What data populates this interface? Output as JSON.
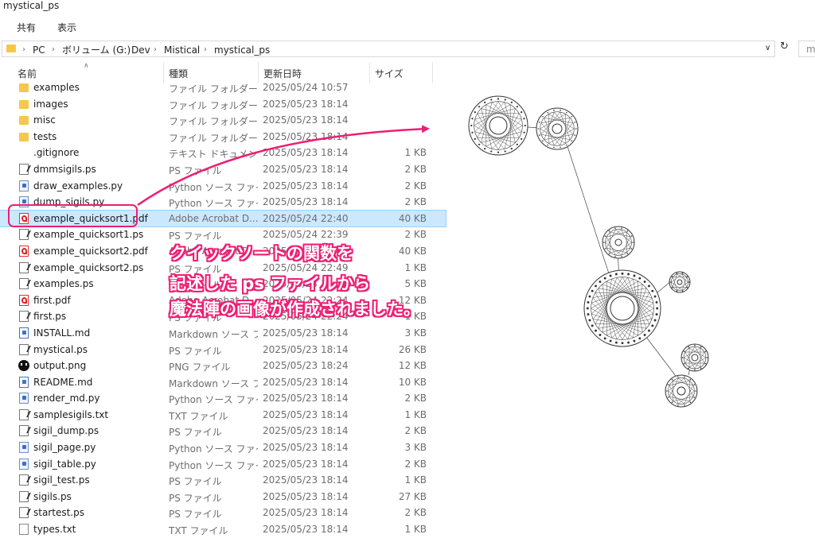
{
  "window": {
    "title": "mystical_ps"
  },
  "ribbon": {
    "tabs": [
      "共有",
      "表示"
    ]
  },
  "address": {
    "crumbs": [
      "PC",
      "ボリューム (G:)",
      "Dev",
      "Mistical",
      "mystical_ps"
    ],
    "search_text": "my"
  },
  "columns": {
    "name": "名前",
    "type": "種類",
    "date": "更新日時",
    "size": "サイズ"
  },
  "files": [
    {
      "name": "examples",
      "type": "ファイル フォルダー",
      "date": "2025/05/24 10:57",
      "size": "",
      "icon": "folder"
    },
    {
      "name": "images",
      "type": "ファイル フォルダー",
      "date": "2025/05/23 18:14",
      "size": "",
      "icon": "folder"
    },
    {
      "name": "misc",
      "type": "ファイル フォルダー",
      "date": "2025/05/23 18:14",
      "size": "",
      "icon": "folder"
    },
    {
      "name": "tests",
      "type": "ファイル フォルダー",
      "date": "2025/05/23 18:14",
      "size": "",
      "icon": "folder"
    },
    {
      "name": ".gitignore",
      "type": "テキスト ドキュメント",
      "date": "2025/05/23 18:14",
      "size": "1 KB",
      "icon": "generic"
    },
    {
      "name": "dmmsigils.ps",
      "type": "PS ファイル",
      "date": "2025/05/23 18:14",
      "size": "2 KB",
      "icon": "ps"
    },
    {
      "name": "draw_examples.py",
      "type": "Python ソース ファイル",
      "date": "2025/05/23 18:14",
      "size": "2 KB",
      "icon": "py"
    },
    {
      "name": "dump_sigils.py",
      "type": "Python ソース ファイル",
      "date": "2025/05/23 18:14",
      "size": "2 KB",
      "icon": "py"
    },
    {
      "name": "example_quicksort1.pdf",
      "type": "Adobe Acrobat D...",
      "date": "2025/05/24 22:40",
      "size": "40 KB",
      "icon": "pdf",
      "selected": true
    },
    {
      "name": "example_quicksort1.ps",
      "type": "PS ファイル",
      "date": "2025/05/24 22:39",
      "size": "2 KB",
      "icon": "ps"
    },
    {
      "name": "example_quicksort2.pdf",
      "type": "Adobe Acrobat D...",
      "date": "2025/05/24 22:49",
      "size": "40 KB",
      "icon": "pdf"
    },
    {
      "name": "example_quicksort2.ps",
      "type": "PS ファイル",
      "date": "2025/05/24 22:49",
      "size": "1 KB",
      "icon": "ps"
    },
    {
      "name": "examples.ps",
      "type": "PS ファイル",
      "date": "2025/05/24 16:12",
      "size": "5 KB",
      "icon": "ps"
    },
    {
      "name": "first.pdf",
      "type": "Adobe Acrobat D...",
      "date": "2025/05/24 22:24",
      "size": "12 KB",
      "icon": "pdf"
    },
    {
      "name": "first.ps",
      "type": "PS ファイル",
      "date": "2025/05/24 22:24",
      "size": "1 KB",
      "icon": "ps"
    },
    {
      "name": "INSTALL.md",
      "type": "Markdown ソース フ...",
      "date": "2025/05/23 18:14",
      "size": "3 KB",
      "icon": "md"
    },
    {
      "name": "mystical.ps",
      "type": "PS ファイル",
      "date": "2025/05/23 18:14",
      "size": "26 KB",
      "icon": "ps"
    },
    {
      "name": "output.png",
      "type": "PNG ファイル",
      "date": "2025/05/23 18:24",
      "size": "12 KB",
      "icon": "png"
    },
    {
      "name": "README.md",
      "type": "Markdown ソース フ...",
      "date": "2025/05/23 18:14",
      "size": "10 KB",
      "icon": "md"
    },
    {
      "name": "render_md.py",
      "type": "Python ソース ファイル",
      "date": "2025/05/23 18:14",
      "size": "2 KB",
      "icon": "py"
    },
    {
      "name": "samplesigils.txt",
      "type": "TXT ファイル",
      "date": "2025/05/23 18:14",
      "size": "1 KB",
      "icon": "ps"
    },
    {
      "name": "sigil_dump.ps",
      "type": "PS ファイル",
      "date": "2025/05/23 18:14",
      "size": "2 KB",
      "icon": "ps"
    },
    {
      "name": "sigil_page.py",
      "type": "Python ソース ファイル",
      "date": "2025/05/23 18:14",
      "size": "3 KB",
      "icon": "py"
    },
    {
      "name": "sigil_table.py",
      "type": "Python ソース ファイル",
      "date": "2025/05/23 18:14",
      "size": "2 KB",
      "icon": "py"
    },
    {
      "name": "sigil_test.ps",
      "type": "PS ファイル",
      "date": "2025/05/23 18:14",
      "size": "1 KB",
      "icon": "ps"
    },
    {
      "name": "sigils.ps",
      "type": "PS ファイル",
      "date": "2025/05/23 18:14",
      "size": "27 KB",
      "icon": "ps"
    },
    {
      "name": "startest.ps",
      "type": "PS ファイル",
      "date": "2025/05/23 18:14",
      "size": "2 KB",
      "icon": "ps"
    },
    {
      "name": "types.txt",
      "type": "TXT ファイル",
      "date": "2025/05/23 18:14",
      "size": "1 KB",
      "icon": "txt"
    }
  ],
  "annotation": {
    "lines": [
      "クイックソートの関数を",
      "記述した ps ファイルから",
      "魔法陣の画像が作成されました。"
    ],
    "color": "#ee1e74"
  }
}
